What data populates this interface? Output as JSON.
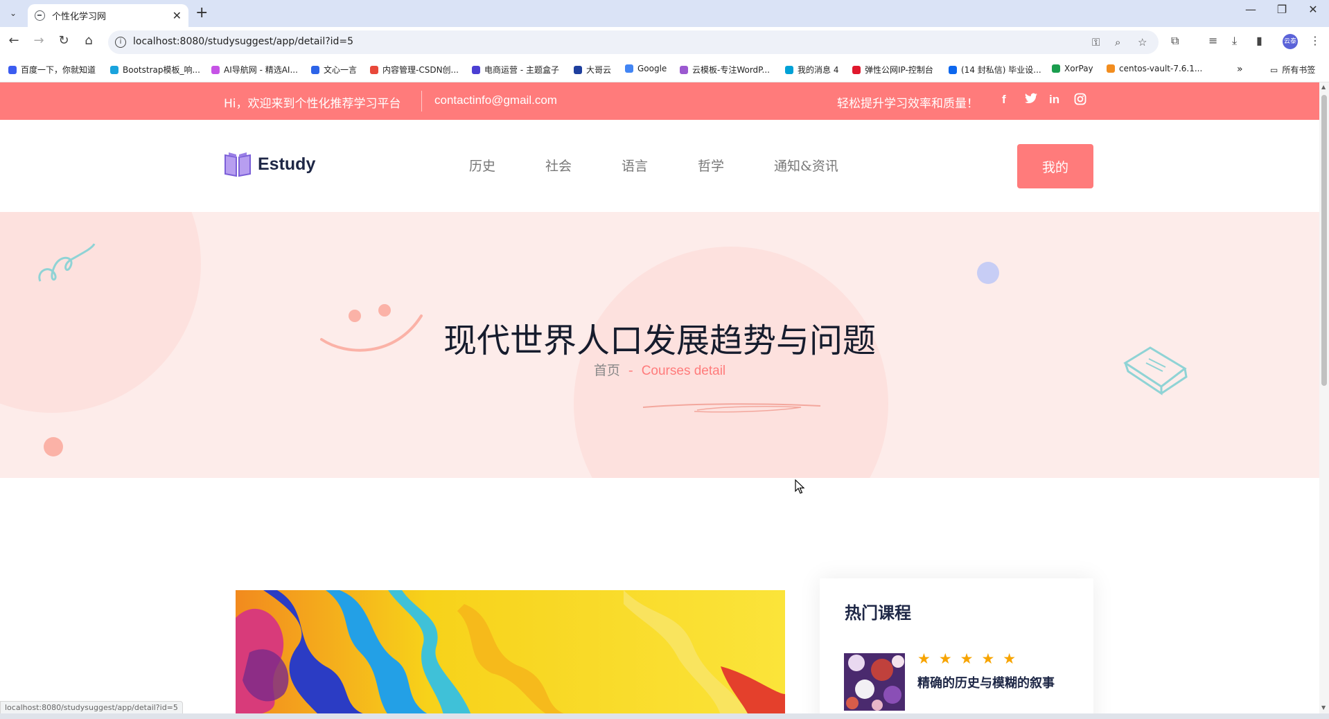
{
  "browser": {
    "tab_title": "个性化学习网",
    "url": "localhost:8080/studysuggest/app/detail?id=5",
    "status_url": "localhost:8080/studysuggest/app/detail?id=5",
    "profile_initials": "云泰",
    "bookmarks": [
      {
        "label": "百度一下，你就知道",
        "color": "#3b5cf0"
      },
      {
        "label": "Bootstrap模板_响...",
        "color": "#1aa3dd"
      },
      {
        "label": "AI导航网 - 精选AI...",
        "color": "#c653e6"
      },
      {
        "label": "文心一言",
        "color": "#2d64e8"
      },
      {
        "label": "内容管理-CSDN创...",
        "color": "#e8483a"
      },
      {
        "label": "电商运营 - 主题盒子",
        "color": "#4b3fd3"
      },
      {
        "label": "大哥云",
        "color": "#1e3f9e"
      },
      {
        "label": "Google",
        "color": "#4285f4"
      },
      {
        "label": "云模板-专注WordP...",
        "color": "#9b59d0"
      },
      {
        "label": "我的消息 4",
        "color": "#00a1d6"
      },
      {
        "label": "弹性公网IP-控制台",
        "color": "#e0182d"
      },
      {
        "label": "(14 封私信) 毕业设...",
        "color": "#0d67ee"
      },
      {
        "label": "XorPay",
        "color": "#1a9d4e"
      },
      {
        "label": "centos-vault-7.6.1...",
        "color": "#f28d1f"
      }
    ],
    "all_bookmarks_label": "所有书签"
  },
  "topbar": {
    "welcome": "Hi，欢迎来到个性化推荐学习平台",
    "email": "contactinfo@gmail.com",
    "slogan": "轻松提升学习效率和质量！",
    "social": {
      "facebook": "f",
      "twitter": "t",
      "linkedin": "in",
      "instagram": "◎"
    }
  },
  "header": {
    "logo": "Estudy",
    "nav": [
      "历史",
      "社会",
      "语言",
      "哲学",
      "通知&资讯"
    ],
    "mine_button": "我的"
  },
  "banner": {
    "title": "现代世界人口发展趋势与问题",
    "breadcrumb_home": "首页",
    "breadcrumb_sep": "-",
    "breadcrumb_current": "Courses detail"
  },
  "sidebar": {
    "title": "热门课程",
    "courses": [
      {
        "title": "精确的历史与模糊的叙事",
        "stars": "★★★★★",
        "rating": 5
      }
    ]
  },
  "colors": {
    "accent": "#ff7b7b",
    "banner_bg": "#fdecea",
    "star": "#f7a400",
    "heading": "#1e2746"
  }
}
